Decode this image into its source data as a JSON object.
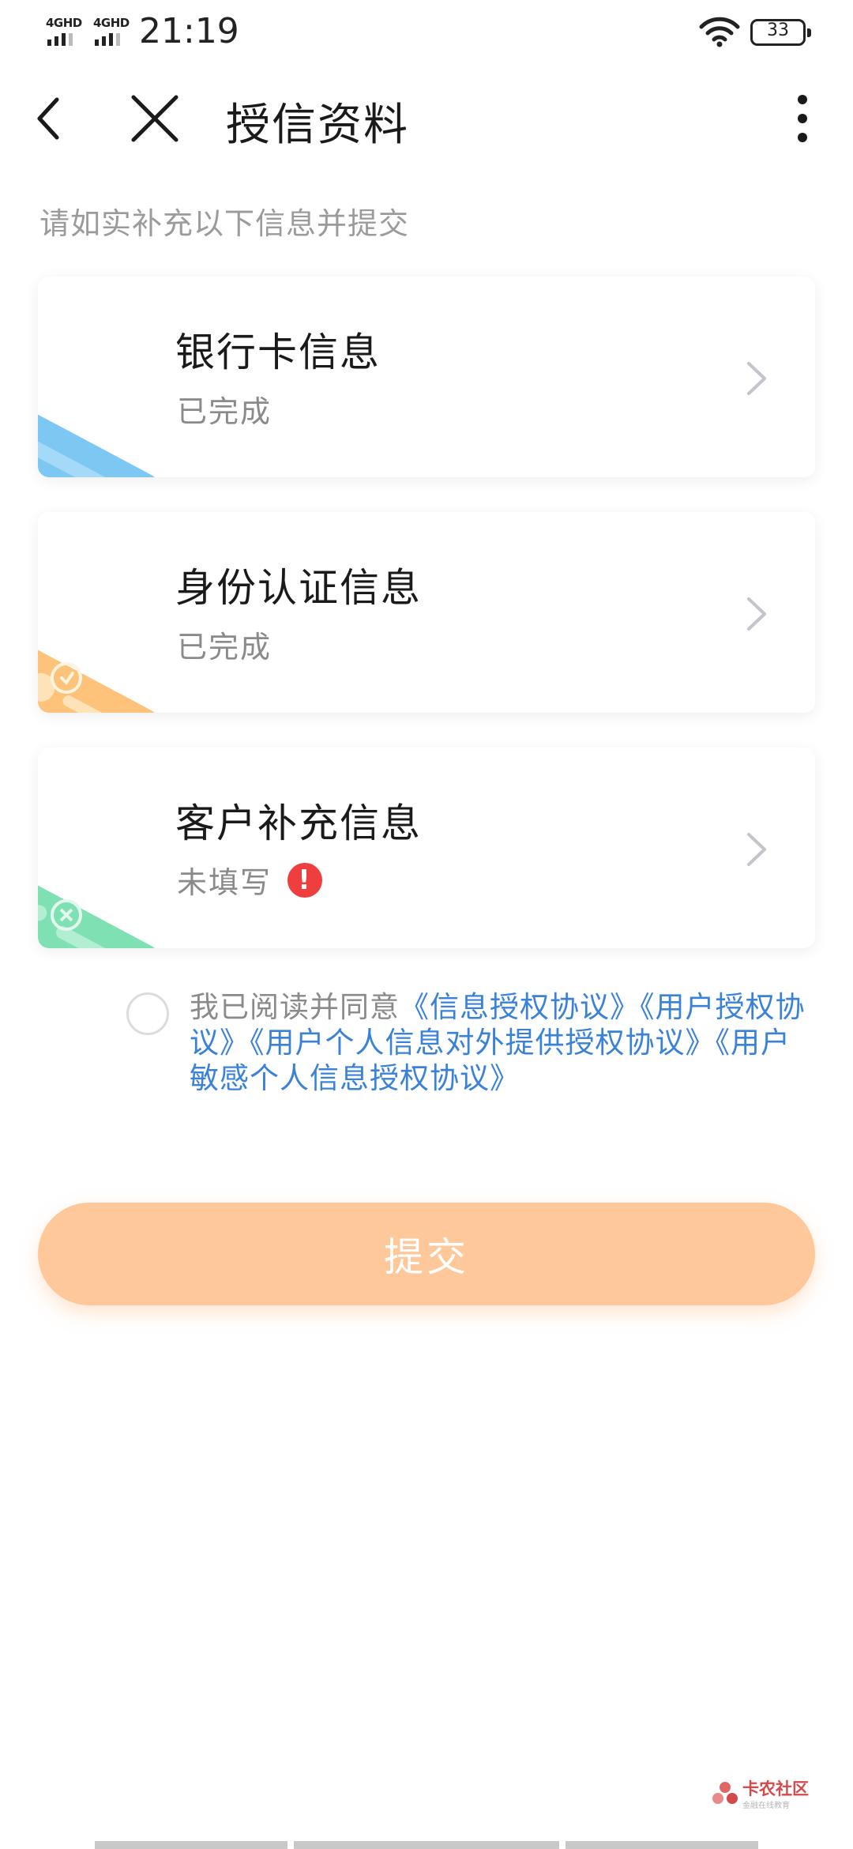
{
  "status_bar": {
    "sim1_label": "4GHD",
    "sim2_label": "4GHD",
    "time": "21:19",
    "battery_level": "33",
    "icons": [
      "signal-icon",
      "wifi-icon",
      "battery-icon"
    ]
  },
  "nav": {
    "title": "授信资料",
    "icons": [
      "back-arrow-icon",
      "close-icon",
      "more-vertical-icon"
    ]
  },
  "hint": "请如实补充以下信息并提交",
  "cards": [
    {
      "title": "银行卡信息",
      "status": "已完成",
      "color": "#7cc8f3",
      "icon": "bank-card-icon"
    },
    {
      "title": "身份认证信息",
      "status": "已完成",
      "color": "#fdc37b",
      "icon": "id-card-icon"
    },
    {
      "title": "客户补充信息",
      "status": "未填写",
      "color": "#7fe0b4",
      "icon": "supplement-card-icon",
      "warning": "!"
    }
  ],
  "agreement": {
    "prefix": "我已阅读并同意",
    "links": [
      "《信息授权协议》",
      "《用户授权协议》",
      "《用户个人信息对外提供授权协议》",
      "《用户敏感个人信息授权协议》"
    ],
    "checked": false
  },
  "submit_label": "提交",
  "watermark": {
    "name": "卡农社区",
    "sub": "金融在线教育"
  },
  "colors": {
    "link": "#3a82d8",
    "submit": "#fec89a",
    "warning": "#ef3e3e",
    "hint": "#9b9b9b"
  }
}
